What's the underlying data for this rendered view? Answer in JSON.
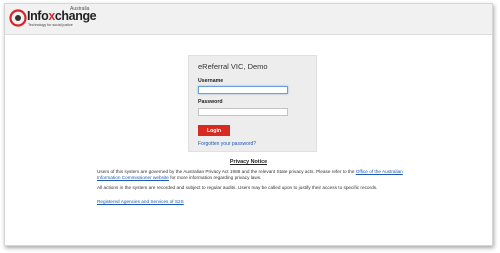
{
  "header": {
    "logo": {
      "name_prefix": "Info",
      "name_x": "x",
      "name_suffix": "change",
      "country": "Australia",
      "tagline": "Technology for social justice"
    }
  },
  "login": {
    "title": "eReferral VIC, Demo",
    "username_label": "Username",
    "username_value": "",
    "password_label": "Password",
    "password_value": "",
    "login_button": "Login",
    "forgot_link": "Forgotten your password?"
  },
  "privacy": {
    "title": "Privacy Notice",
    "para1_text": "Users of this system are governed by the Australian Privacy Act 1988 and the relevant State privacy acts. Please refer to the",
    "para1_link": "Office of the Australian Information Commissioner website",
    "para1_tail": "for more information regarding privacy laws.",
    "para2": "All actions in the system are recorded and subject to regular audits. Users may be called upon to justify their access to specific records.",
    "services_link": "Registered Agencies and Services of S2S"
  },
  "colors": {
    "brand_red": "#d92a22",
    "link_blue": "#1e57b6"
  }
}
